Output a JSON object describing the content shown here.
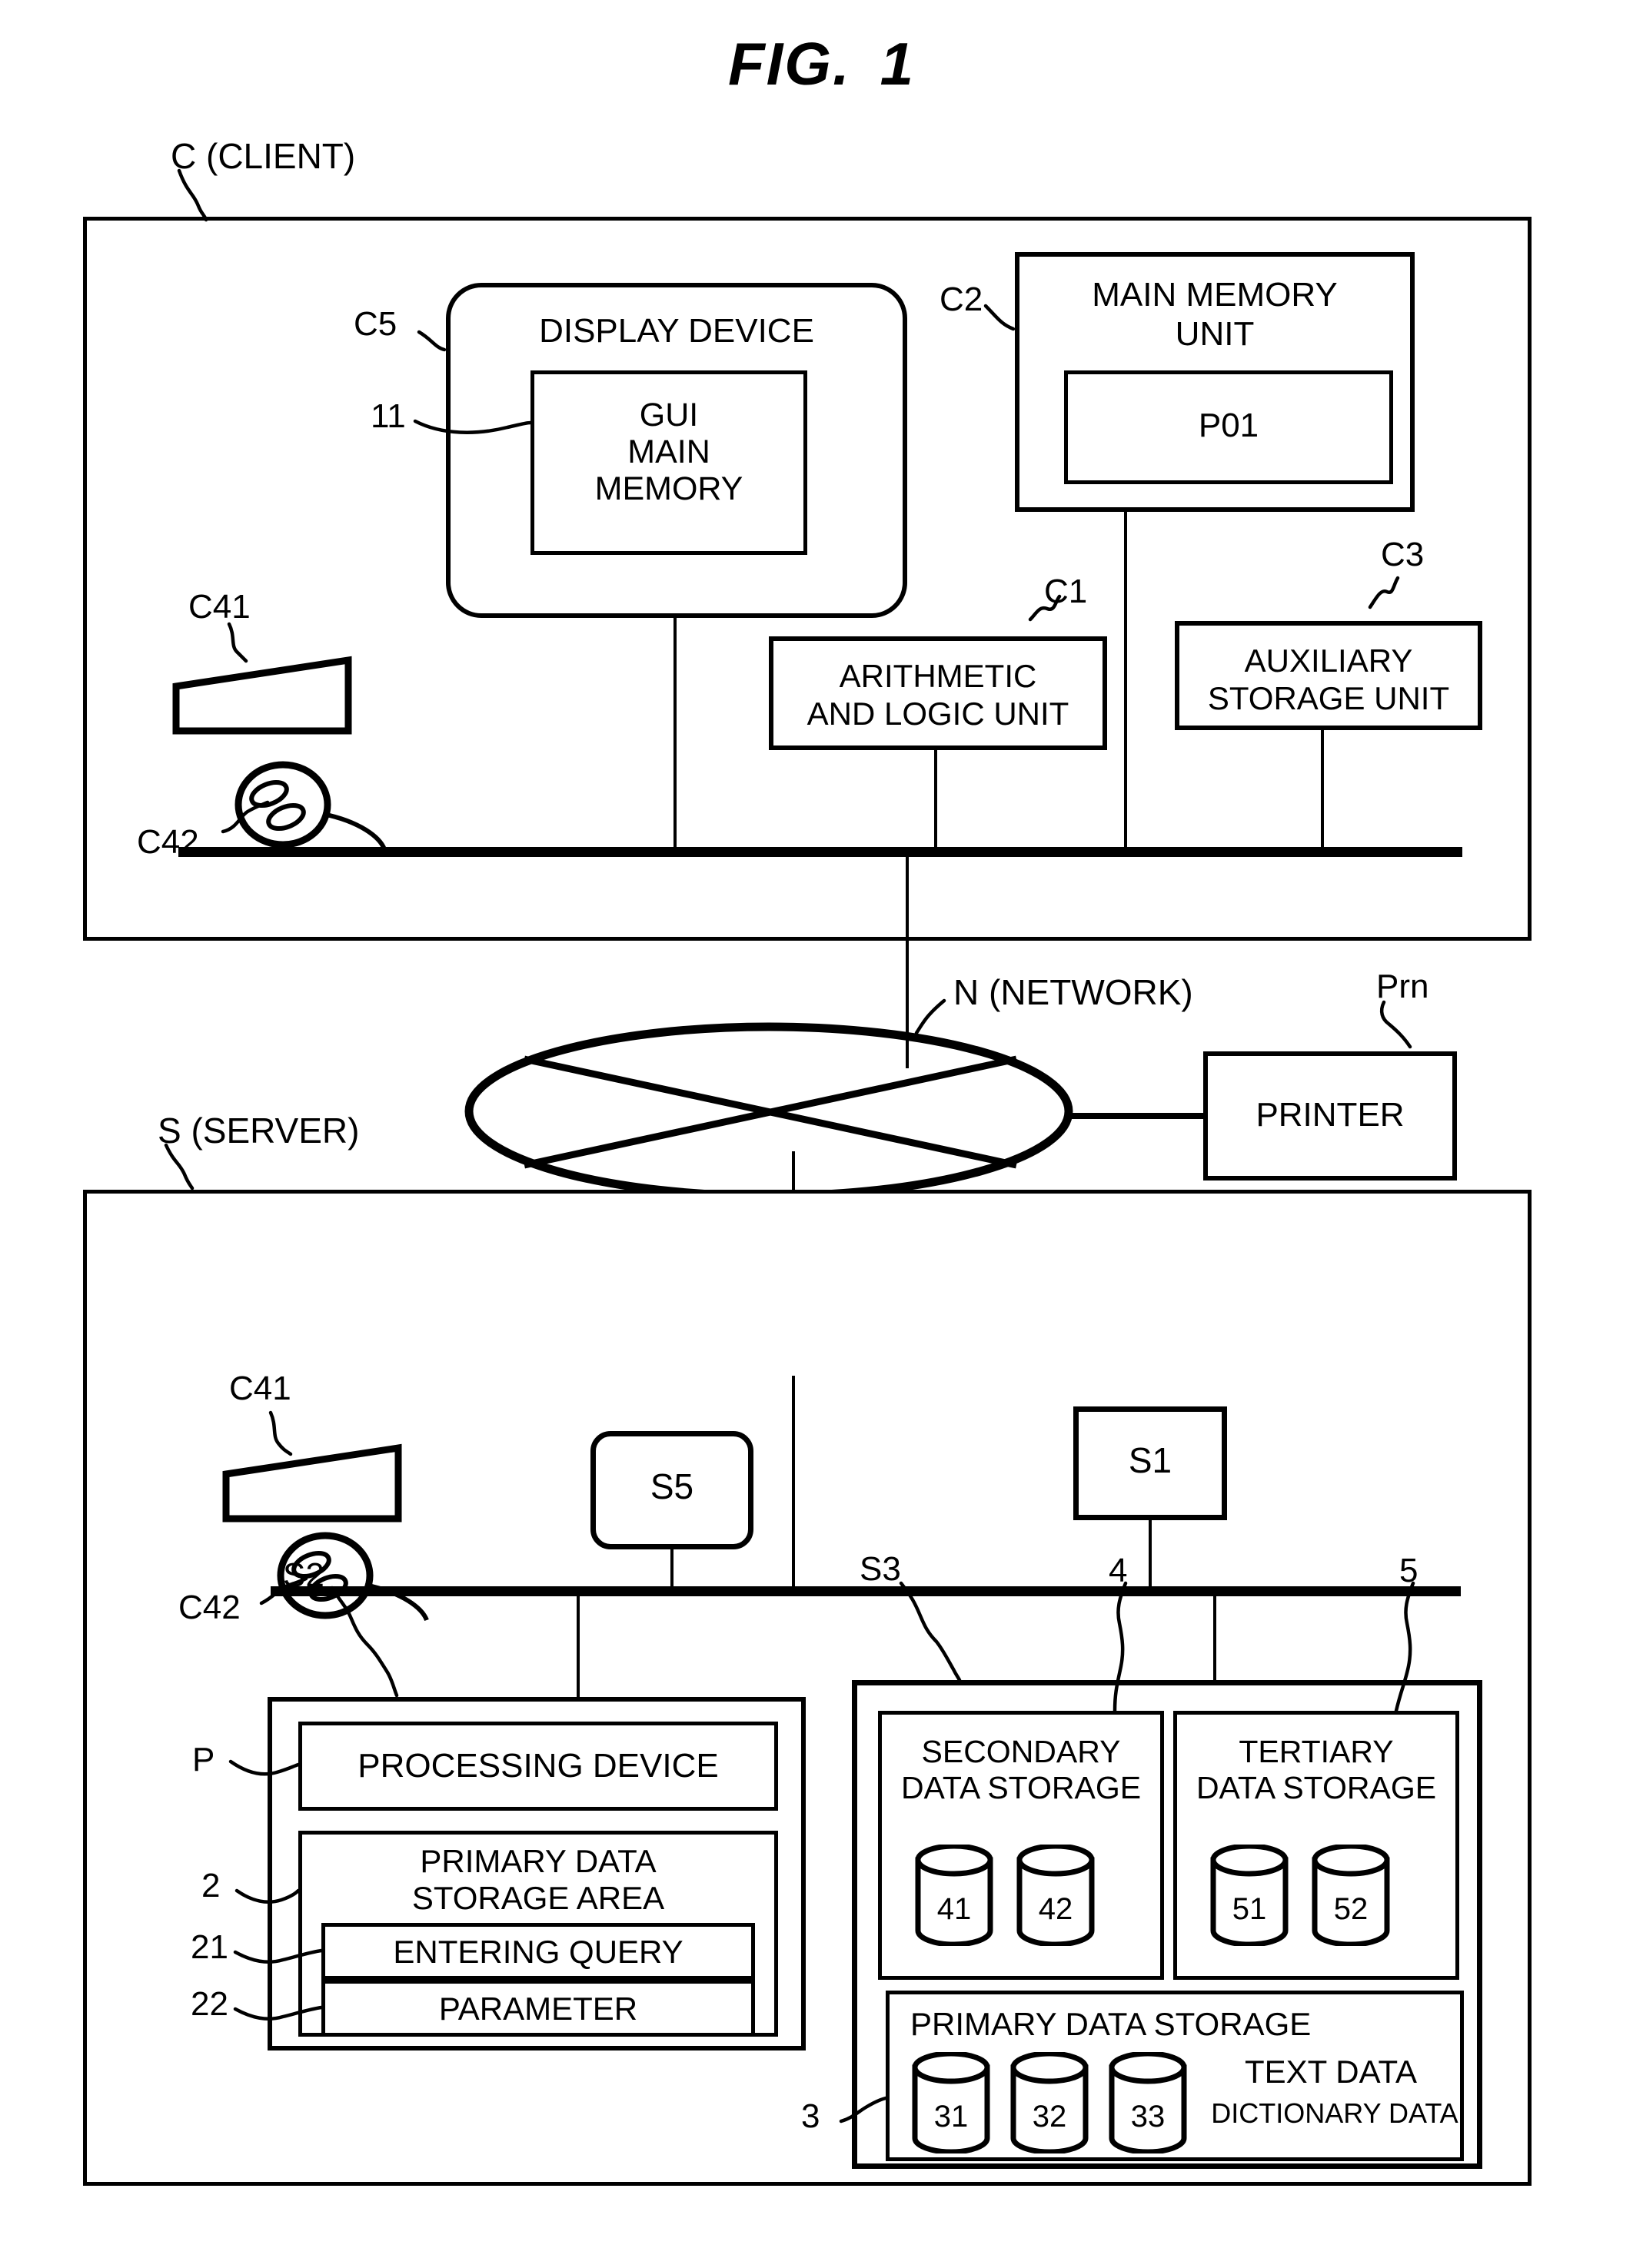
{
  "figure": {
    "title_prefix": "FIG.",
    "title_number": "1"
  },
  "client": {
    "ref_label": "C (CLIENT)",
    "display_device": {
      "ref_label": "C5",
      "title": "DISPLAY DEVICE",
      "inner": {
        "ref_label": "11",
        "title": "GUI\nMAIN\nMEMORY"
      }
    },
    "main_memory_unit": {
      "ref_label": "C2",
      "title": "MAIN MEMORY\nUNIT",
      "inner": {
        "title": "P01"
      }
    },
    "arithmetic_unit": {
      "ref_label": "C1",
      "title": "ARITHMETIC\nAND LOGIC UNIT"
    },
    "auxiliary_storage": {
      "ref_label": "C3",
      "title": "AUXILIARY\nSTORAGE UNIT"
    },
    "keyboard": {
      "ref_label": "C41"
    },
    "mouse": {
      "ref_label": "C42"
    }
  },
  "network": {
    "ref_label": "N (NETWORK)",
    "printer": {
      "ref_label": "Prn",
      "title": "PRINTER"
    }
  },
  "server": {
    "ref_label": "S (SERVER)",
    "keyboard": {
      "ref_label": "C41"
    },
    "mouse": {
      "ref_label": "C42"
    },
    "s5_box": {
      "title": "S5"
    },
    "s1_box": {
      "title": "S1"
    },
    "s2_box": {
      "ref_label": "S2",
      "processing_device": {
        "ref_label": "P",
        "title": "PROCESSING DEVICE"
      },
      "primary_data_storage_area": {
        "ref_label": "2",
        "title": "PRIMARY DATA\nSTORAGE AREA",
        "entering_query": {
          "ref_label": "21",
          "title": "ENTERING QUERY"
        },
        "parameter": {
          "ref_label": "22",
          "title": "PARAMETER"
        }
      }
    },
    "s3_box": {
      "ref_label": "S3",
      "secondary_data_storage": {
        "ref_label": "4",
        "title": "SECONDARY\nDATA STORAGE",
        "disks": [
          "41",
          "42"
        ]
      },
      "tertiary_data_storage": {
        "ref_label": "5",
        "title": "TERTIARY\nDATA STORAGE",
        "disks": [
          "51",
          "52"
        ]
      },
      "primary_data_storage": {
        "ref_label": "3",
        "title": "PRIMARY DATA STORAGE",
        "disks": [
          "31",
          "32",
          "33"
        ],
        "text_data_label": "TEXT DATA",
        "dictionary_data_label": "DICTIONARY DATA"
      }
    }
  }
}
